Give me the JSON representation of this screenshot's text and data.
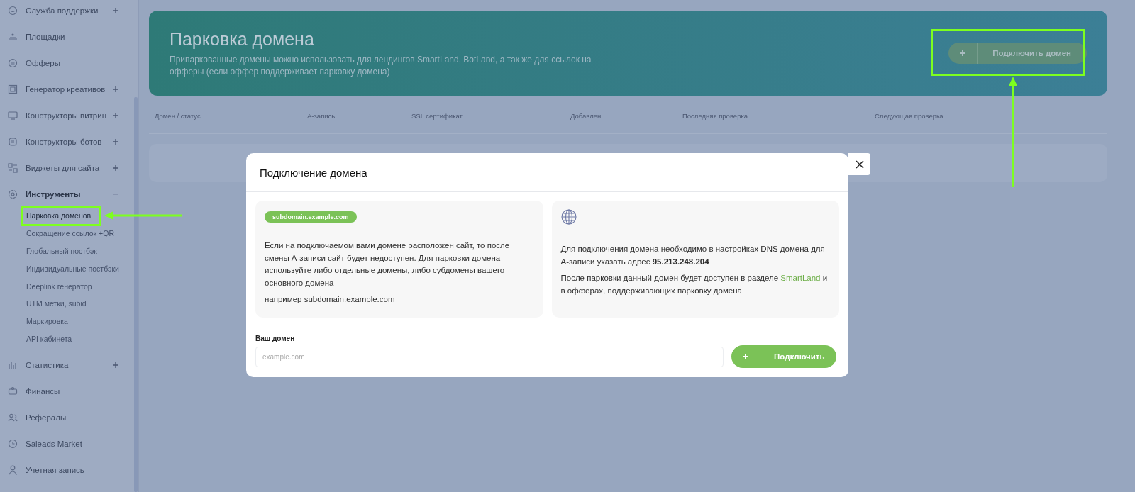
{
  "sidebar": {
    "items": [
      {
        "label": "Служба поддержки",
        "expandable": true,
        "expanded": false
      },
      {
        "label": "Площадки",
        "expandable": false,
        "expanded": false
      },
      {
        "label": "Офферы",
        "expandable": false,
        "expanded": false
      },
      {
        "label": "Генератор креативов",
        "expandable": true,
        "expanded": false
      },
      {
        "label": "Конструкторы витрин",
        "expandable": true,
        "expanded": false
      },
      {
        "label": "Конструкторы ботов",
        "expandable": true,
        "expanded": false
      },
      {
        "label": "Виджеты для сайта",
        "expandable": true,
        "expanded": false
      },
      {
        "label": "Инструменты",
        "expandable": true,
        "expanded": true,
        "children": [
          {
            "label": "Парковка доменов",
            "selected": true,
            "highlighted": true
          },
          {
            "label": "Сокращение ссылок +QR",
            "selected": false,
            "highlighted": false
          },
          {
            "label": "Глобальный постбэк",
            "selected": false,
            "highlighted": false
          },
          {
            "label": "Индивидуальные постбэки",
            "selected": false,
            "highlighted": false
          },
          {
            "label": "Deeplink генератор",
            "selected": false,
            "highlighted": false
          },
          {
            "label": "UTM метки, subid",
            "selected": false,
            "highlighted": false
          },
          {
            "label": "Маркировка",
            "selected": false,
            "highlighted": false
          },
          {
            "label": "API кабинета",
            "selected": false,
            "highlighted": false
          }
        ]
      },
      {
        "label": "Статистика",
        "expandable": true,
        "expanded": false
      },
      {
        "label": "Финансы",
        "expandable": false,
        "expanded": false
      },
      {
        "label": "Рефералы",
        "expandable": false,
        "expanded": false
      },
      {
        "label": "Saleads Market",
        "expandable": false,
        "expanded": false
      },
      {
        "label": "Учетная запись",
        "expandable": false,
        "expanded": false
      }
    ]
  },
  "header": {
    "title": "Парковка домена",
    "description": "Припаркованные домены можно использовать для лендингов SmartLand, BotLand, а так же для ссылок на офферы (если оффер поддерживает парковку домена)",
    "button": {
      "label": "Подключить домен",
      "highlighted": true
    }
  },
  "table": {
    "columns": [
      "Домен / статус",
      "A-запись",
      "SSL сертификат",
      "Добавлен",
      "Последняя проверка",
      "Следующая проверка"
    ]
  },
  "modal": {
    "title": "Подключение домена",
    "left_panel": {
      "tag": "subdomain.example.com",
      "text": "Если на подключаемом вами домене расположен сайт, то после смены А-записи сайт будет недоступен. Для парковки домена используйте либо отдельные домены, либо субдомены вашего основного домена",
      "example": "например subdomain.example.com"
    },
    "right_panel": {
      "text": "Для подключения домена необходимо в настройках DNS домена для А-записи указать адрес **95.213.248.204**",
      "note_before": "После парковки данный домен будет доступен в разделе ",
      "note_link": "SmartLand",
      "note_after": " и в офферах, поддерживающих парковку домена"
    },
    "field": {
      "label": "Ваш домен",
      "placeholder": "example.com"
    },
    "button": {
      "label": "Подключить"
    }
  }
}
